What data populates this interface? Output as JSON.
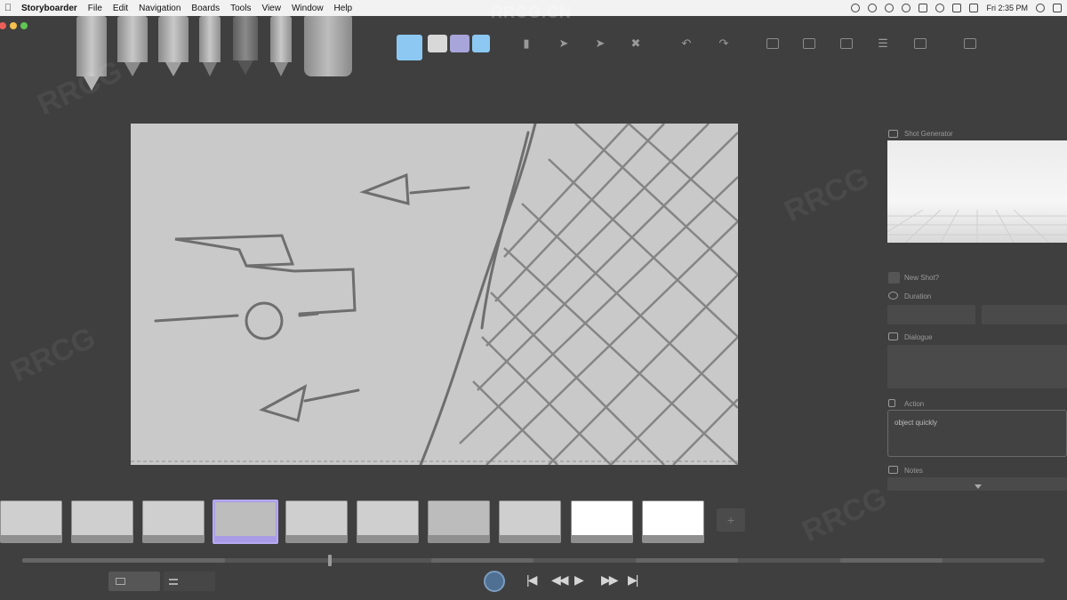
{
  "menubar": {
    "apple_icon": "apple-logo-icon",
    "app_name": "Storyboarder",
    "items": [
      "File",
      "Edit",
      "Navigation",
      "Boards",
      "Tools",
      "View",
      "Window",
      "Help"
    ],
    "clock": "Fri 2:35 PM"
  },
  "watermark": "RRCG.CN",
  "palette": {
    "colors": [
      "#8cc8f2",
      "#d8d8d8",
      "#a7a5d9",
      "#8cc8f2"
    ]
  },
  "right_panel": {
    "shot_generator_label": "Shot Generator",
    "new_shot_label": "New Shot?",
    "duration_label": "Duration",
    "dialogue_label": "Dialogue",
    "action_label": "Action",
    "action_value": "object quickly",
    "notes_label": "Notes"
  },
  "thumbnails": [
    {
      "selected": false,
      "blank": false
    },
    {
      "selected": false,
      "blank": false
    },
    {
      "selected": false,
      "blank": false
    },
    {
      "selected": true,
      "blank": false
    },
    {
      "selected": false,
      "blank": false
    },
    {
      "selected": false,
      "blank": false
    },
    {
      "selected": false,
      "blank": false
    },
    {
      "selected": false,
      "blank": false
    },
    {
      "selected": false,
      "blank": true
    },
    {
      "selected": false,
      "blank": true
    }
  ],
  "add_board_label": "+",
  "playback": {
    "prev_icon": "skip-back-icon",
    "rewind_icon": "rewind-icon",
    "play_icon": "play-icon",
    "forward_icon": "fast-forward-icon",
    "next_icon": "skip-forward-icon"
  }
}
